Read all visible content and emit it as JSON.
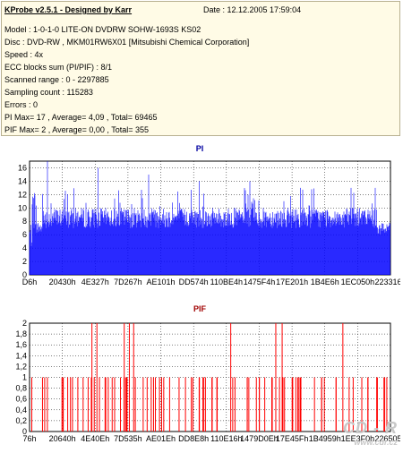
{
  "header": {
    "title": "KProbe v2.5.1 - Designed by Karr",
    "date": "Date : 12.12.2005 17:59:04"
  },
  "info_lines": [
    "Model : 1-0-1-0 LITE-ON DVDRW SOHW-1693S KS02",
    "Disc : DVD-RW , MKM01RW6X01 [Mitsubishi Chemical Corporation]",
    "Speed : 4x",
    "ECC blocks sum (PI/PIF) : 8/1",
    "Scanned range : 0 - 2297885",
    "Sampling count : 115283",
    "Errors : 0",
    "PI Max= 17 , Average= 4,09 , Total= 69465",
    "PIF Max= 2 , Average= 0,00 , Total= 355"
  ],
  "watermark": {
    "big": "CD - R",
    "small": "www.cdr.cz"
  },
  "chart_data": [
    {
      "type": "bar",
      "title": "PI",
      "ylim": [
        0,
        17
      ],
      "yticks": [
        0,
        2,
        4,
        6,
        8,
        10,
        12,
        14,
        16
      ],
      "xtick_labels": [
        "D6h",
        "20430h",
        "4E327h",
        "7D267h",
        "AE101h",
        "DD574h",
        "110BE4h",
        "1475F4h",
        "17E201h",
        "1B4E6h",
        "1EC050h",
        "223316h"
      ],
      "color": "#0000ff",
      "grid": true,
      "baseline_level": 9,
      "peak_values": [
        17,
        16,
        15,
        14,
        14,
        13,
        13
      ]
    },
    {
      "type": "bar",
      "title": "PIF",
      "ylim": [
        0,
        2
      ],
      "yticks": [
        "0",
        "0,2",
        "0,4",
        "0,6",
        "0,8",
        "1",
        "1,2",
        "1,4",
        "1,6",
        "1,8",
        "2"
      ],
      "ytick_values": [
        0,
        0.2,
        0.4,
        0.6,
        0.8,
        1,
        1.2,
        1.4,
        1.6,
        1.8,
        2
      ],
      "xtick_labels": [
        "76h",
        "20640h",
        "4E40Eh",
        "7D535h",
        "AE01Eh",
        "DD8E8h",
        "110E16h",
        "1479D0Eh",
        "17E45Fh",
        "1B4959h",
        "1EE3F0h",
        "226505h"
      ],
      "color": "#ff0000",
      "grid": true,
      "values_present": [
        1,
        2
      ]
    }
  ]
}
